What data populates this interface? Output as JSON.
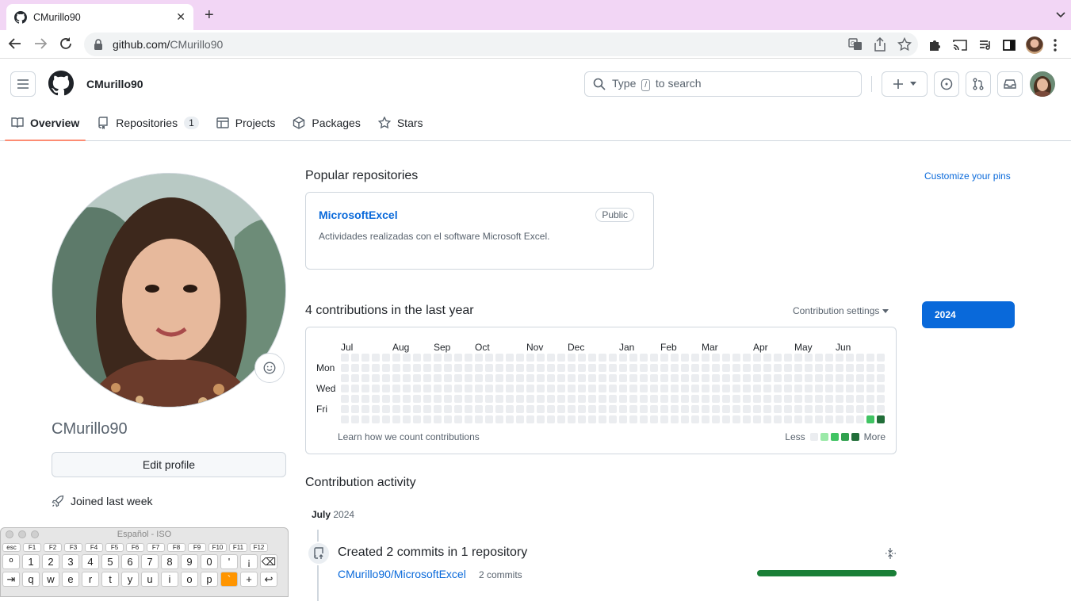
{
  "browser": {
    "tab_title": "CMurillo90",
    "url_host": "github.com/",
    "url_path": "CMurillo90"
  },
  "header": {
    "username": "CMurillo90",
    "search_prefix": "Type",
    "search_key": "/",
    "search_suffix": "to search"
  },
  "nav": {
    "tabs": [
      {
        "label": "Overview",
        "icon": "book-icon",
        "selected": true
      },
      {
        "label": "Repositories",
        "icon": "repo-icon",
        "count": "1"
      },
      {
        "label": "Projects",
        "icon": "table-icon"
      },
      {
        "label": "Packages",
        "icon": "package-icon"
      },
      {
        "label": "Stars",
        "icon": "star-icon"
      }
    ]
  },
  "profile": {
    "login": "CMurillo90",
    "edit_label": "Edit profile",
    "joined": "Joined last week"
  },
  "keyboard_viewer": {
    "title": "Español - ISO",
    "fn_row": [
      "esc",
      "F1",
      "F2",
      "F3",
      "F4",
      "F5",
      "F6",
      "F7",
      "F8",
      "F9",
      "F10",
      "F11",
      "F12"
    ],
    "num_row": [
      "º",
      "1",
      "2",
      "3",
      "4",
      "5",
      "6",
      "7",
      "8",
      "9",
      "0",
      "'",
      "¡",
      "⌫"
    ],
    "q_row": [
      "⇥",
      "q",
      "w",
      "e",
      "r",
      "t",
      "y",
      "u",
      "i",
      "o",
      "p",
      "`",
      "+",
      "↩"
    ],
    "highlight_key": "`"
  },
  "popular": {
    "title": "Popular repositories",
    "customize": "Customize your pins",
    "repos": [
      {
        "name": "MicrosoftExcel",
        "visibility": "Public",
        "description": "Actividades realizadas con el software Microsoft Excel."
      }
    ]
  },
  "contributions": {
    "title": "4 contributions in the last year",
    "settings": "Contribution settings",
    "year": "2024",
    "months": [
      "Jul",
      "Aug",
      "Sep",
      "Oct",
      "Nov",
      "Dec",
      "Jan",
      "Feb",
      "Mar",
      "Apr",
      "May",
      "Jun"
    ],
    "days": [
      "Mon",
      "Wed",
      "Fri"
    ],
    "learn": "Learn how we count contributions",
    "less": "Less",
    "more": "More",
    "weeks": 53,
    "levels": [
      "#ebedf0",
      "#9be9a8",
      "#40c463",
      "#30a14e",
      "#216e39"
    ],
    "filled_cells": [
      {
        "week": 51,
        "day": 6,
        "level": 2
      },
      {
        "week": 52,
        "day": 6,
        "level": 4
      }
    ]
  },
  "activity": {
    "title": "Contribution activity",
    "month": "July",
    "year": "2024",
    "event_title": "Created 2 commits in 1 repository",
    "repo": "CMurillo90/MicrosoftExcel",
    "commits": "2 commits"
  }
}
